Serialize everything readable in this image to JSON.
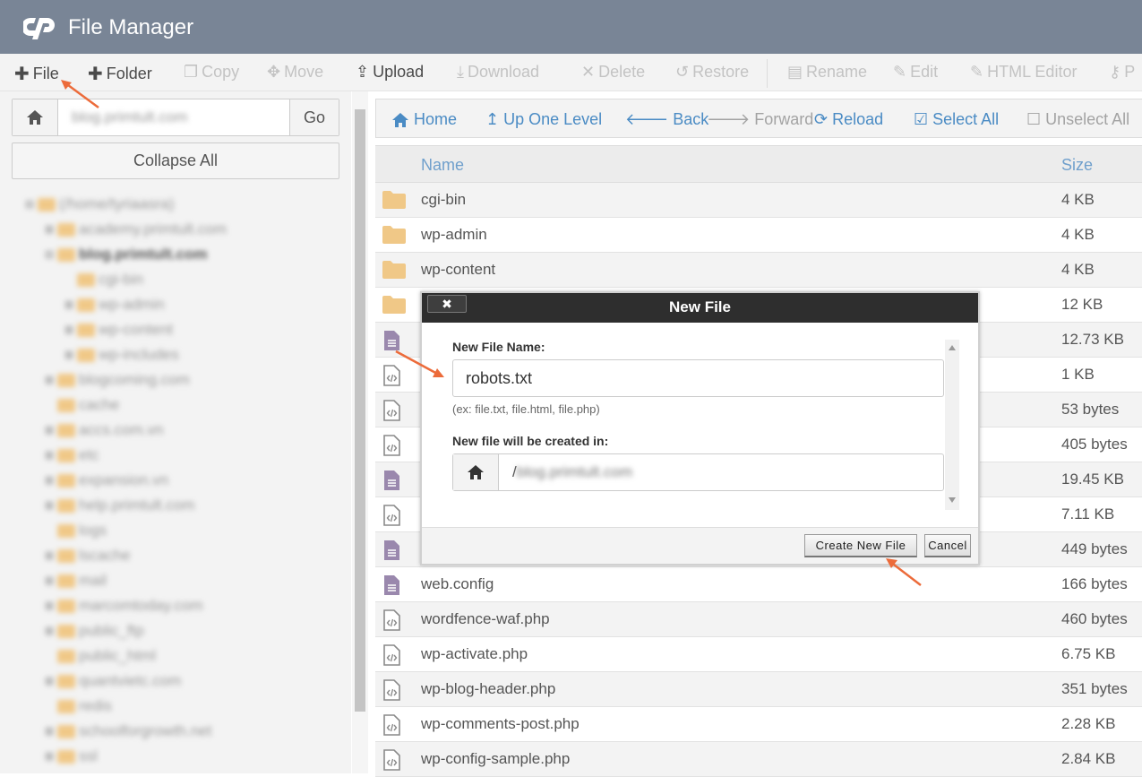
{
  "app": {
    "title": "File Manager",
    "logo": "cP"
  },
  "toolbar": {
    "file": "File",
    "folder": "Folder",
    "copy": "Copy",
    "move": "Move",
    "upload": "Upload",
    "download": "Download",
    "delete": "Delete",
    "restore": "Restore",
    "rename": "Rename",
    "edit": "Edit",
    "html_editor": "HTML Editor",
    "permissions": "P"
  },
  "sidebar": {
    "path_value": "blog.primtult.com",
    "go_label": "Go",
    "collapse_label": "Collapse All",
    "tree": [
      "(/home/tyriaasra)",
      "academy.primtult.com",
      "blog.primtult.com",
      "cgi-bin",
      "wp-admin",
      "wp-content",
      "wp-includes",
      "blogcoming.com",
      "cache",
      "accs.com.vn",
      "etc",
      "expansion.vn",
      "help.primtult.com",
      "logs",
      "lscache",
      "mail",
      "marcomtoday.com",
      "public_ftp",
      "public_html",
      "quantvietc.com",
      "redis",
      "schoolforgrowth.net",
      "ssl"
    ]
  },
  "nav": {
    "home": "Home",
    "up": "Up One Level",
    "back": "Back",
    "forward": "Forward",
    "reload": "Reload",
    "select_all": "Select All",
    "unselect_all": "Unselect All"
  },
  "table": {
    "columns": {
      "name": "Name",
      "size": "Size"
    },
    "rows": [
      {
        "name": "cgi-bin",
        "size": "4 KB",
        "icon": "folder-icon"
      },
      {
        "name": "wp-admin",
        "size": "4 KB",
        "icon": "folder-icon"
      },
      {
        "name": "wp-content",
        "size": "4 KB",
        "icon": "folder-icon"
      },
      {
        "name": "",
        "size": "12 KB",
        "icon": "folder-icon"
      },
      {
        "name": "",
        "size": "12.73 KB",
        "icon": "text-file-icon"
      },
      {
        "name": "",
        "size": "1 KB",
        "icon": "code-file-icon"
      },
      {
        "name": "",
        "size": "53 bytes",
        "icon": "code-file-icon"
      },
      {
        "name": "",
        "size": "405 bytes",
        "icon": "code-file-icon"
      },
      {
        "name": "",
        "size": "19.45 KB",
        "icon": "text-file-icon"
      },
      {
        "name": "",
        "size": "7.11 KB",
        "icon": "code-file-icon"
      },
      {
        "name": "",
        "size": "449 bytes",
        "icon": "text-file-icon"
      },
      {
        "name": "web.config",
        "size": "166 bytes",
        "icon": "text-file-icon"
      },
      {
        "name": "wordfence-waf.php",
        "size": "460 bytes",
        "icon": "code-file-icon"
      },
      {
        "name": "wp-activate.php",
        "size": "6.75 KB",
        "icon": "code-file-icon"
      },
      {
        "name": "wp-blog-header.php",
        "size": "351 bytes",
        "icon": "code-file-icon"
      },
      {
        "name": "wp-comments-post.php",
        "size": "2.28 KB",
        "icon": "code-file-icon"
      },
      {
        "name": "wp-config-sample.php",
        "size": "2.84 KB",
        "icon": "code-file-icon"
      }
    ]
  },
  "modal": {
    "title": "New File",
    "close": "✖",
    "name_label": "New File Name:",
    "name_value": "robots.txt",
    "hint": "(ex: file.txt, file.html, file.php)",
    "dest_label": "New file will be created in:",
    "dest_prefix": "/",
    "dest_value": "blog.primtult.com",
    "create_label": "Create New File",
    "cancel_label": "Cancel"
  },
  "colors": {
    "header": "#798596",
    "link": "#4a8bc4",
    "folder": "#f0c887",
    "file": "#9a88ad",
    "arrow": "#ec6b3a"
  }
}
